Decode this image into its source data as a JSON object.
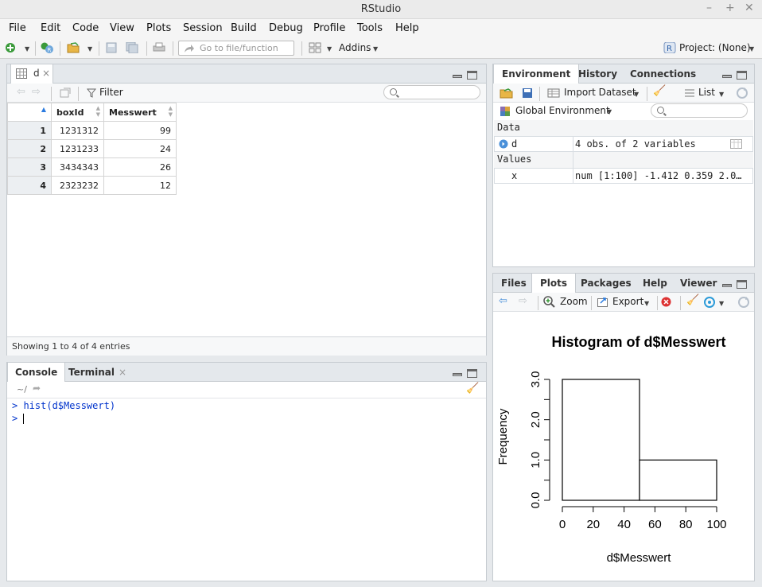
{
  "window": {
    "title": "RStudio",
    "controls": [
      "–",
      "+",
      "✕"
    ]
  },
  "menu": [
    "File",
    "Edit",
    "Code",
    "View",
    "Plots",
    "Session",
    "Build",
    "Debug",
    "Profile",
    "Tools",
    "Help"
  ],
  "toolbar": {
    "goto_placeholder": "Go to file/function",
    "addins_label": "Addins",
    "project_label": "Project: (None)"
  },
  "source": {
    "tab_label": "d",
    "filter_label": "Filter",
    "columns": [
      "boxId",
      "Messwert"
    ],
    "rows": [
      {
        "n": "1",
        "boxId": "1231312",
        "Messwert": "99"
      },
      {
        "n": "2",
        "boxId": "1231233",
        "Messwert": "24"
      },
      {
        "n": "3",
        "boxId": "3434343",
        "Messwert": "26"
      },
      {
        "n": "4",
        "boxId": "2323232",
        "Messwert": "12"
      }
    ],
    "status": "Showing 1 to 4 of 4 entries"
  },
  "console": {
    "tabs": [
      "Console",
      "Terminal"
    ],
    "path": "~/",
    "lines": [
      "> hist(d$Messwert)",
      "> "
    ]
  },
  "environment": {
    "tabs": [
      "Environment",
      "History",
      "Connections"
    ],
    "import_label": "Import Dataset",
    "list_label": "List",
    "scope_label": "Global Environment",
    "data_header": "Data",
    "values_header": "Values",
    "data_rows": [
      {
        "name": "d",
        "value": "4 obs. of 2 variables"
      }
    ],
    "value_rows": [
      {
        "name": "x",
        "value": "num [1:100] -1.412 0.359 2.0…"
      }
    ]
  },
  "files": {
    "tabs": [
      "Files",
      "Plots",
      "Packages",
      "Help",
      "Viewer"
    ],
    "zoom_label": "Zoom",
    "export_label": "Export"
  },
  "chart_data": {
    "type": "bar",
    "title": "Histogram of d$Messwert",
    "xlabel": "d$Messwert",
    "ylabel": "Frequency",
    "bins": [
      {
        "from": 0,
        "to": 50,
        "count": 3
      },
      {
        "from": 50,
        "to": 100,
        "count": 1
      }
    ],
    "x_ticks": [
      0,
      20,
      40,
      60,
      80,
      100
    ],
    "y_ticks": [
      "0.0",
      "1.0",
      "2.0",
      "3.0"
    ],
    "xlim": [
      0,
      100
    ],
    "ylim": [
      0,
      3
    ]
  }
}
